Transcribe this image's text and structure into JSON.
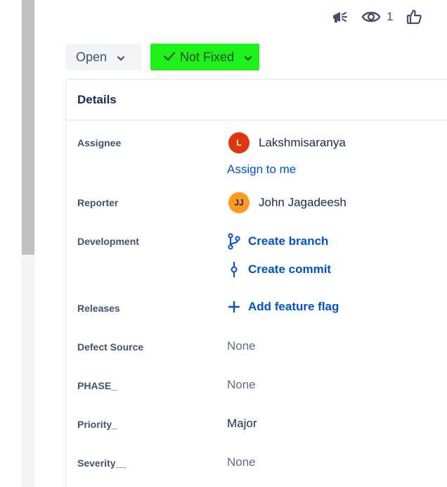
{
  "top_actions": {
    "watch_count": "1"
  },
  "status": {
    "workflow_label": "Open",
    "resolution_label": "Not Fixed",
    "resolution_color": "#1ef01a"
  },
  "details": {
    "title": "Details",
    "fields": {
      "assignee": {
        "label": "Assignee",
        "name": "Lakshmisaranya",
        "initials": "L",
        "assign_to_me": "Assign to me"
      },
      "reporter": {
        "label": "Reporter",
        "name": "John Jagadeesh",
        "initials": "JJ"
      },
      "development": {
        "label": "Development",
        "create_branch": "Create branch",
        "create_commit": "Create commit"
      },
      "releases": {
        "label": "Releases",
        "add_feature_flag": "Add feature flag"
      },
      "defect_source": {
        "label": "Defect Source",
        "value": "None"
      },
      "phase": {
        "label": "PHASE_",
        "value": "None"
      },
      "priority": {
        "label": "Priority_",
        "value": "Major"
      },
      "severity": {
        "label": "Severity__",
        "value": "None"
      }
    }
  }
}
